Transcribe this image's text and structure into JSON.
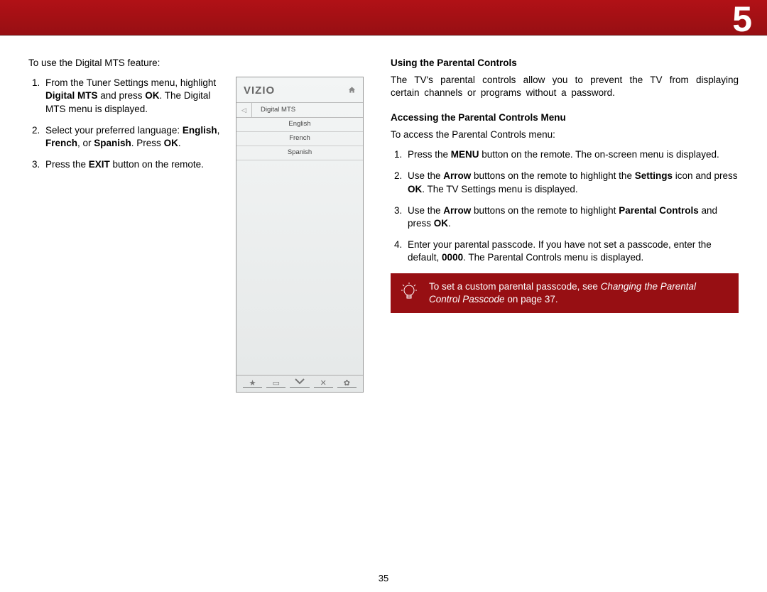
{
  "chapter": "5",
  "page_number": "35",
  "left": {
    "intro": "To use the Digital MTS feature:",
    "step1_a": "From the Tuner Settings menu, highlight ",
    "step1_b_bold": "Digital MTS",
    "step1_c": " and press ",
    "step1_d_bold": "OK",
    "step1_e": ". The Digital MTS menu is displayed.",
    "step2_a": "Select your preferred language: ",
    "step2_b_bold": "English",
    "step2_c": ", ",
    "step2_d_bold": "French",
    "step2_e": ", or ",
    "step2_f_bold": "Spanish",
    "step2_g": ". Press ",
    "step2_h_bold": "OK",
    "step2_i": ".",
    "step3_a": "Press the ",
    "step3_b_bold": "EXIT",
    "step3_c": " button on the remote."
  },
  "tv": {
    "logo": "VIZIO",
    "menu_title": "Digital MTS",
    "items": [
      "English",
      "French",
      "Spanish"
    ]
  },
  "right": {
    "h1": "Using the Parental Controls",
    "p1": "The TV's parental controls allow you to prevent the TV from displaying certain channels or programs without a password.",
    "h2": "Accessing the Parental Controls Menu",
    "p2": "To access the Parental Controls menu:",
    "s1_a": "Press the ",
    "s1_b_bold": "MENU",
    "s1_c": " button on the remote. The on-screen menu is displayed.",
    "s2_a": "Use the ",
    "s2_b_bold": "Arrow",
    "s2_c": " buttons on the remote to highlight the ",
    "s2_d_bold": "Settings",
    "s2_e": " icon and press ",
    "s2_f_bold": "OK",
    "s2_g": ". The TV Settings menu is displayed.",
    "s3_a": "Use the ",
    "s3_b_bold": "Arrow",
    "s3_c": " buttons on the remote to highlight ",
    "s3_d_bold": "Parental Controls",
    "s3_e": " and press ",
    "s3_f_bold": "OK",
    "s3_g": ".",
    "s4_a": "Enter your parental passcode. If you have not set a passcode, enter the default, ",
    "s4_b_bold": "0000",
    "s4_c": ". The Parental Controls menu is displayed.",
    "tip_a": "To set a custom parental passcode, see ",
    "tip_b_italic": "Changing the Parental Control Passcode",
    "tip_c": " on page 37."
  }
}
